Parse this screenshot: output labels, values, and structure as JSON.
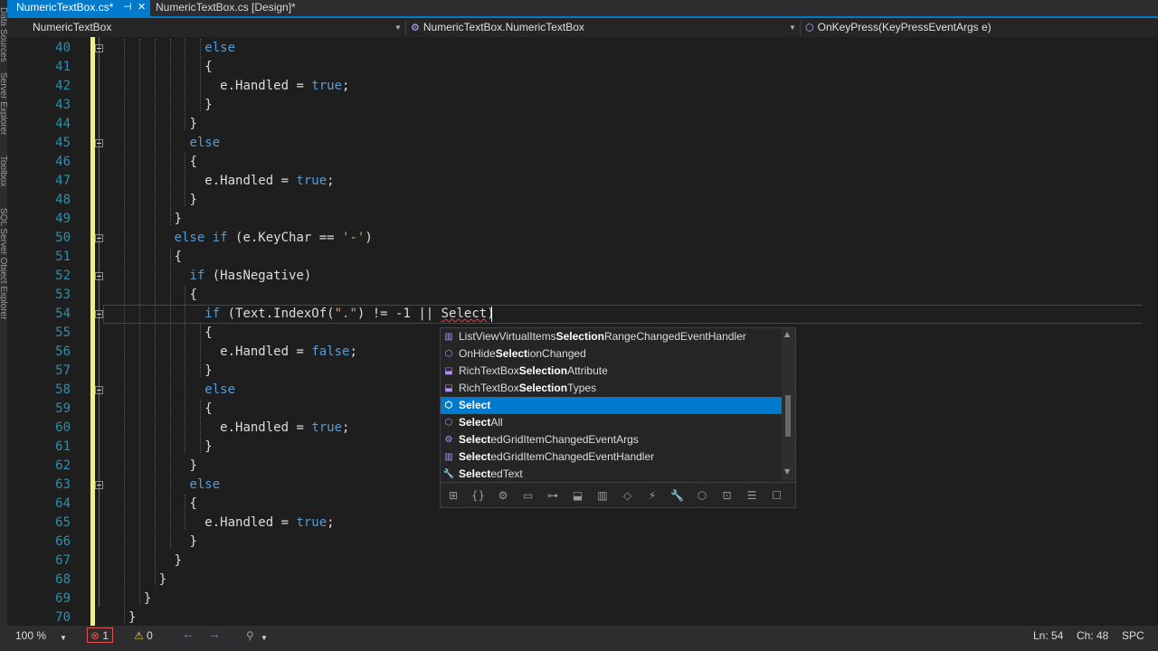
{
  "tool_windows": [
    "Data Sources",
    "Server Explorer",
    "Toolbox",
    "SQL Server Object Explorer"
  ],
  "tabs": [
    {
      "label": "NumericTextBox.cs*",
      "active": true
    },
    {
      "label": "NumericTextBox.cs [Design]*",
      "active": false
    }
  ],
  "tab_pin_icon": "pin-icon",
  "tab_close_icon": "close-icon",
  "navbar": {
    "project": "NumericTextBox",
    "type": "NumericTextBox.NumericTextBox",
    "member": "OnKeyPress(KeyPressEventArgs e)"
  },
  "code_lines": [
    {
      "n": "40",
      "indent": 10,
      "segs": [
        {
          "t": "else",
          "c": "kw"
        }
      ]
    },
    {
      "n": "41",
      "indent": 10,
      "segs": [
        {
          "t": "{"
        }
      ]
    },
    {
      "n": "42",
      "indent": 12,
      "segs": [
        {
          "t": "e.Handled = "
        },
        {
          "t": "true",
          "c": "kw"
        },
        {
          "t": ";"
        }
      ]
    },
    {
      "n": "43",
      "indent": 10,
      "segs": [
        {
          "t": "}"
        }
      ]
    },
    {
      "n": "44",
      "indent": 8,
      "segs": [
        {
          "t": "}"
        }
      ]
    },
    {
      "n": "45",
      "indent": 8,
      "segs": [
        {
          "t": "else",
          "c": "kw"
        }
      ]
    },
    {
      "n": "46",
      "indent": 8,
      "segs": [
        {
          "t": "{"
        }
      ]
    },
    {
      "n": "47",
      "indent": 10,
      "segs": [
        {
          "t": "e.Handled = "
        },
        {
          "t": "true",
          "c": "kw"
        },
        {
          "t": ";"
        }
      ]
    },
    {
      "n": "48",
      "indent": 8,
      "segs": [
        {
          "t": "}"
        }
      ]
    },
    {
      "n": "49",
      "indent": 6,
      "segs": [
        {
          "t": "}"
        }
      ]
    },
    {
      "n": "50",
      "indent": 6,
      "segs": [
        {
          "t": "else if",
          "c": "kw"
        },
        {
          "t": " (e.KeyChar == "
        },
        {
          "t": "'-'",
          "c": "str"
        },
        {
          "t": ")"
        }
      ]
    },
    {
      "n": "51",
      "indent": 6,
      "segs": [
        {
          "t": "{"
        }
      ]
    },
    {
      "n": "52",
      "indent": 8,
      "segs": [
        {
          "t": "if",
          "c": "kw"
        },
        {
          "t": " (HasNegative)"
        }
      ]
    },
    {
      "n": "53",
      "indent": 8,
      "segs": [
        {
          "t": "{"
        }
      ]
    },
    {
      "n": "54",
      "indent": 10,
      "segs": [
        {
          "t": "if",
          "c": "kw"
        },
        {
          "t": " (Text.IndexOf("
        },
        {
          "t": "\".\"",
          "c": "str"
        },
        {
          "t": ") != -1 || "
        },
        {
          "t": "Select",
          "c": "err"
        },
        {
          "t": ")"
        }
      ]
    },
    {
      "n": "55",
      "indent": 10,
      "segs": [
        {
          "t": "{"
        }
      ]
    },
    {
      "n": "56",
      "indent": 12,
      "segs": [
        {
          "t": "e.Handled = "
        },
        {
          "t": "false",
          "c": "kw"
        },
        {
          "t": ";"
        }
      ]
    },
    {
      "n": "57",
      "indent": 10,
      "segs": [
        {
          "t": "}"
        }
      ]
    },
    {
      "n": "58",
      "indent": 10,
      "segs": [
        {
          "t": "else",
          "c": "kw"
        }
      ]
    },
    {
      "n": "59",
      "indent": 10,
      "segs": [
        {
          "t": "{"
        }
      ]
    },
    {
      "n": "60",
      "indent": 12,
      "segs": [
        {
          "t": "e.Handled = "
        },
        {
          "t": "true",
          "c": "kw"
        },
        {
          "t": ";"
        }
      ]
    },
    {
      "n": "61",
      "indent": 10,
      "segs": [
        {
          "t": "}"
        }
      ]
    },
    {
      "n": "62",
      "indent": 8,
      "segs": [
        {
          "t": "}"
        }
      ]
    },
    {
      "n": "63",
      "indent": 8,
      "segs": [
        {
          "t": "else",
          "c": "kw"
        }
      ]
    },
    {
      "n": "64",
      "indent": 8,
      "segs": [
        {
          "t": "{"
        }
      ]
    },
    {
      "n": "65",
      "indent": 10,
      "segs": [
        {
          "t": "e.Handled = "
        },
        {
          "t": "true",
          "c": "kw"
        },
        {
          "t": ";"
        }
      ]
    },
    {
      "n": "66",
      "indent": 8,
      "segs": [
        {
          "t": "}"
        }
      ]
    },
    {
      "n": "67",
      "indent": 6,
      "segs": [
        {
          "t": "}"
        }
      ]
    },
    {
      "n": "68",
      "indent": 4,
      "segs": [
        {
          "t": "}"
        }
      ]
    },
    {
      "n": "69",
      "indent": 2,
      "segs": [
        {
          "t": "}"
        }
      ]
    },
    {
      "n": "70",
      "indent": 0,
      "segs": [
        {
          "t": "}"
        }
      ]
    }
  ],
  "completion": {
    "items": [
      {
        "pre": "ListViewVirtualItems",
        "match": "Selection",
        "post": "RangeChangedEventHandler",
        "icon": "delegate-icon",
        "glyph": "▥",
        "selected": false
      },
      {
        "pre": "OnHide",
        "match": "Select",
        "post": "ionChanged",
        "icon": "extension-method-icon",
        "glyph": "⬡",
        "selected": false
      },
      {
        "pre": "RichTextBox",
        "match": "Selection",
        "post": "Attribute",
        "icon": "class-icon",
        "glyph": "⬓",
        "selected": false
      },
      {
        "pre": "RichTextBox",
        "match": "Selection",
        "post": "Types",
        "icon": "class-icon",
        "glyph": "⬓",
        "selected": false
      },
      {
        "pre": "",
        "match": "Select",
        "post": "",
        "icon": "method-icon",
        "glyph": "⬡",
        "selected": true
      },
      {
        "pre": "",
        "match": "Select",
        "post": "All",
        "icon": "method-icon",
        "glyph": "⬡",
        "selected": false
      },
      {
        "pre": "",
        "match": "Select",
        "post": "edGridItemChangedEventArgs",
        "icon": "class-icon",
        "glyph": "⚙",
        "selected": false
      },
      {
        "pre": "",
        "match": "Select",
        "post": "edGridItemChangedEventHandler",
        "icon": "delegate-icon",
        "glyph": "▥",
        "selected": false
      },
      {
        "pre": "",
        "match": "Select",
        "post": "edText",
        "icon": "property-icon",
        "glyph": "🔧",
        "selected": false
      }
    ],
    "filters": [
      {
        "name": "locals-filter-icon",
        "glyph": "⊞"
      },
      {
        "name": "namespaces-filter-icon",
        "glyph": "{}"
      },
      {
        "name": "classes-filter-icon",
        "glyph": "⚙"
      },
      {
        "name": "structures-filter-icon",
        "glyph": "▭"
      },
      {
        "name": "interfaces-filter-icon",
        "glyph": "⊶"
      },
      {
        "name": "enums-filter-icon",
        "glyph": "⬓"
      },
      {
        "name": "delegates-filter-icon",
        "glyph": "▥"
      },
      {
        "name": "modules-filter-icon",
        "glyph": "◇"
      },
      {
        "name": "events-filter-icon",
        "glyph": "⚡"
      },
      {
        "name": "properties-filter-icon",
        "glyph": "🔧"
      },
      {
        "name": "methods-filter-icon",
        "glyph": "⬡"
      },
      {
        "name": "extension-methods-filter-icon",
        "glyph": "⊡"
      },
      {
        "name": "keywords-filter-icon",
        "glyph": "☰"
      },
      {
        "name": "snippets-filter-icon",
        "glyph": "☐"
      }
    ]
  },
  "status": {
    "zoom": "100 %",
    "errors": "1",
    "warnings": "0",
    "line": "Ln: 54",
    "col": "Ch: 48",
    "mode": "SPC"
  },
  "colors": {
    "accent": "#007acc",
    "keyword": "#569cd6",
    "string": "#d69d85",
    "line_number": "#2b91af",
    "change_marker": "#efef90"
  }
}
